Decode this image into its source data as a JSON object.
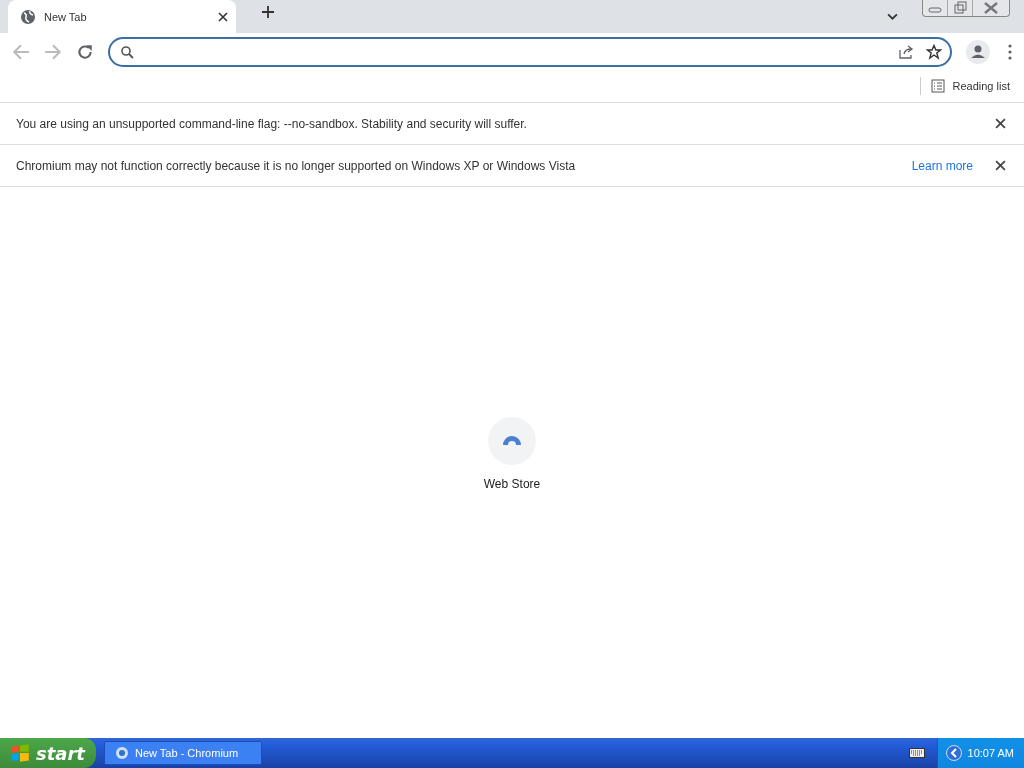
{
  "tabs": [
    {
      "title": "New Tab",
      "selected": true
    }
  ],
  "toolbar": {
    "back_disabled": true,
    "forward_disabled": true
  },
  "bookmarks_bar": {
    "reading_list": "Reading list"
  },
  "infobars": [
    {
      "message": "You are using an unsupported command-line flag: --no-sandbox. Stability and security will suffer."
    },
    {
      "message": "Chromium may not function correctly because it is no longer supported on Windows XP or Windows Vista",
      "link": "Learn more"
    }
  ],
  "shortcuts": [
    {
      "title": "Web Store"
    }
  ],
  "taskbar": {
    "start": "start",
    "tasks": [
      {
        "title": "New Tab - Chromium",
        "selected": false
      }
    ],
    "clock": "10:07 AM"
  }
}
